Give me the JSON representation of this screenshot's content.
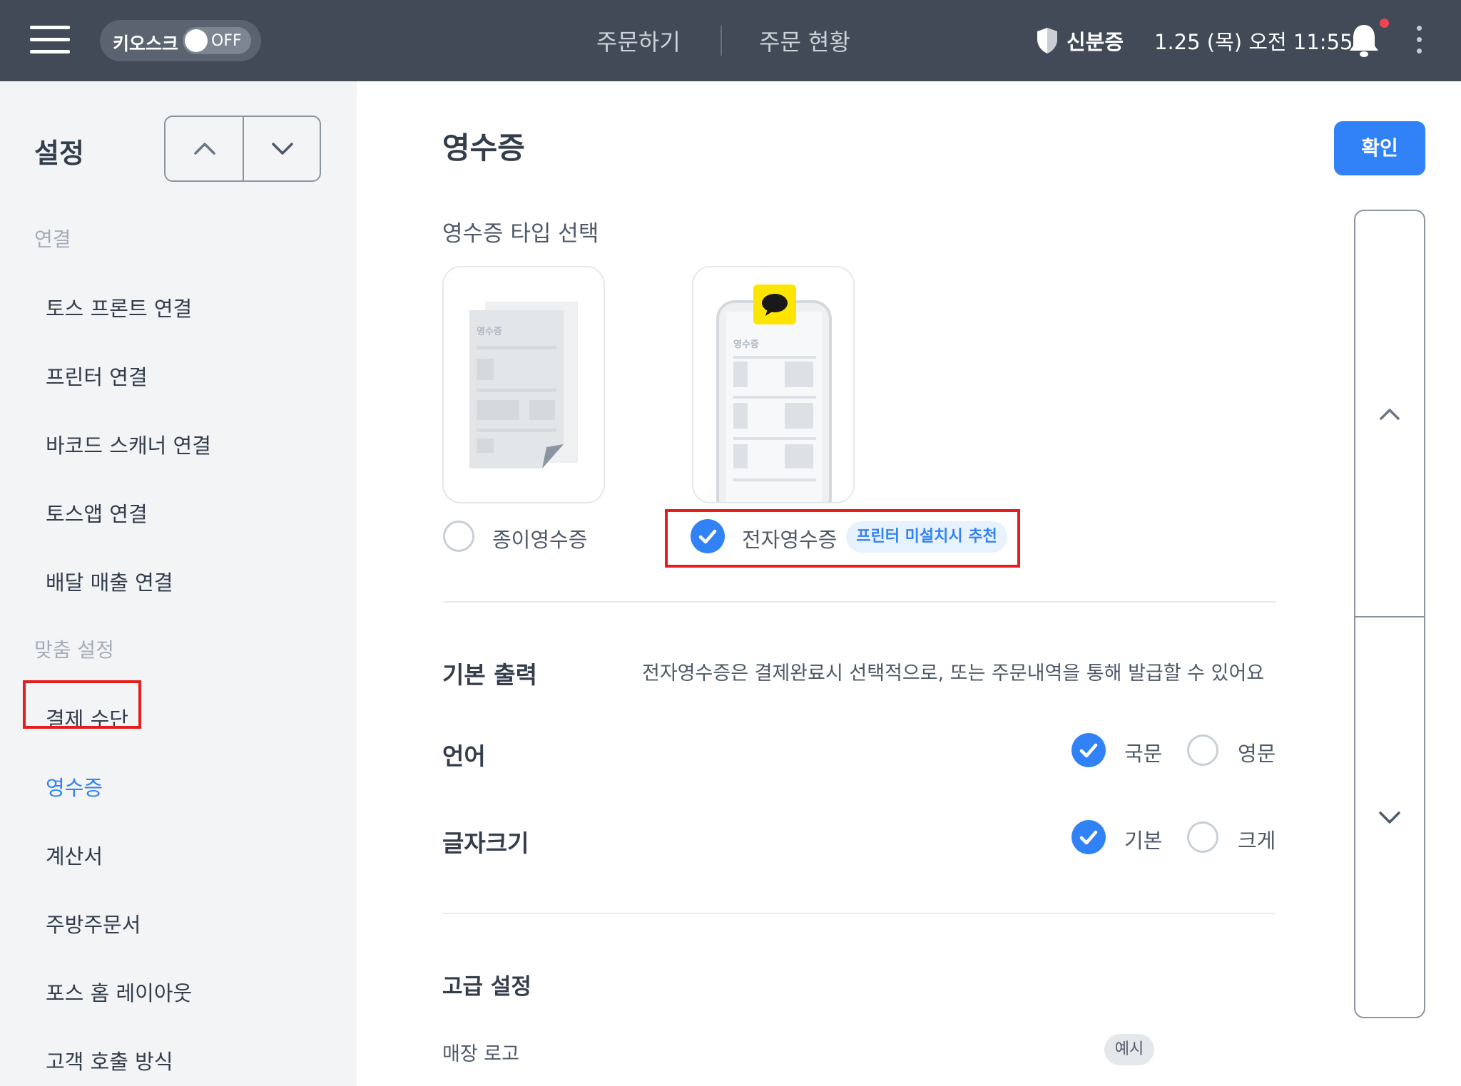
{
  "topbar": {
    "kiosk_label": "키오스크",
    "kiosk_toggle": "OFF",
    "nav": [
      "주문하기",
      "주문 현황"
    ],
    "id_label": "신분증",
    "datetime": "1.25 (목) 오전 11:55"
  },
  "sidebar": {
    "title": "설정",
    "section_connect": "연결",
    "connect_items": [
      "토스 프론트 연결",
      "프린터 연결",
      "바코드 스캐너 연결",
      "토스앱 연결",
      "배달 매출 연결"
    ],
    "section_custom": "맞춤 설정",
    "custom_items": [
      "결제 수단",
      "영수증",
      "계산서",
      "주방주문서",
      "포스 홈 레이아웃",
      "고객 호출 방식"
    ],
    "active_item": "영수증"
  },
  "main": {
    "title": "영수증",
    "confirm": "확인",
    "type_heading": "영수증 타입 선택",
    "paper_label": "종이영수증",
    "electronic_label": "전자영수증",
    "recommend_badge": "프린터 미설치시 추천",
    "card_text": "영수증",
    "selected_type": "전자영수증",
    "basic_output": "기본 출력",
    "basic_output_desc": "전자영수증은 결제완료시 선택적으로, 또는 주문내역을 통해 발급할 수 있어요",
    "language": "언어",
    "language_options": [
      "국문",
      "영문"
    ],
    "language_selected": "국문",
    "font_size": "글자크기",
    "font_size_options": [
      "기본",
      "크게"
    ],
    "font_size_selected": "기본",
    "advanced": "고급 설정",
    "store_logo": "매장 로고",
    "example_badge": "예시"
  },
  "colors": {
    "topbar": "#414a56",
    "accent": "#3182f6",
    "highlight": "#e51d1d",
    "sidebar": "#f2f4f6",
    "kakao": "#fee500"
  },
  "icons": [
    "hamburger-icon",
    "shield-icon",
    "bell-icon",
    "kebab-icon",
    "chevron-up-icon",
    "chevron-down-icon",
    "check-icon",
    "speech-bubble-icon"
  ]
}
